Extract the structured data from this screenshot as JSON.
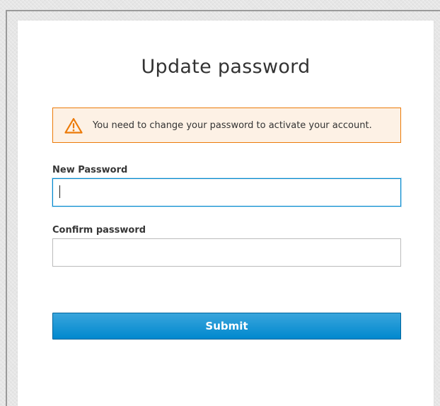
{
  "page": {
    "title": "Update password"
  },
  "alert": {
    "icon": "warning-triangle-icon",
    "message": "You need to change your password to activate your account.",
    "colors": {
      "border": "#ec7a08",
      "background": "#fdf1e5"
    }
  },
  "form": {
    "new_password": {
      "label": "New Password",
      "value": "",
      "placeholder": "",
      "focused": true
    },
    "confirm_password": {
      "label": "Confirm password",
      "value": "",
      "placeholder": ""
    },
    "submit_label": "Submit"
  },
  "colors": {
    "accent": "#0088ce",
    "accent_light": "#39a5dc",
    "text": "#333333"
  }
}
